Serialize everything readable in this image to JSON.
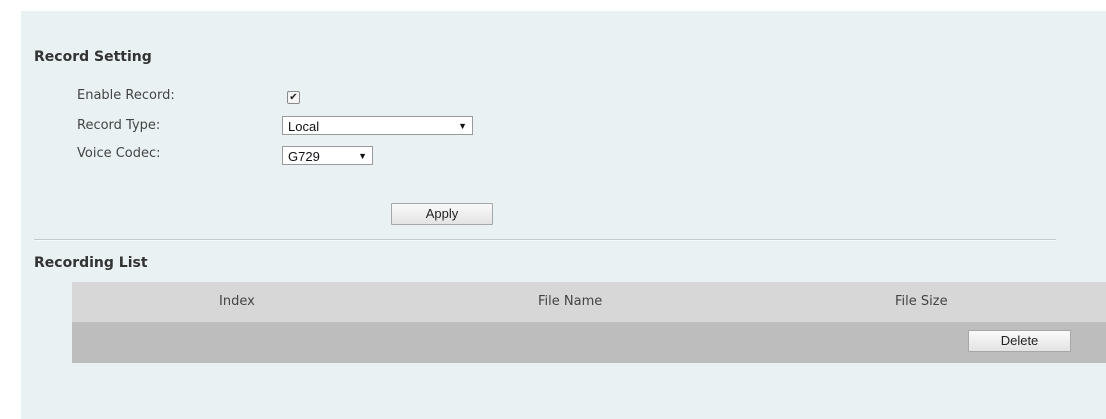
{
  "record_setting": {
    "title": "Record Setting",
    "enable_record": {
      "label": "Enable Record:",
      "checked": true,
      "check_glyph": "✔"
    },
    "record_type": {
      "label": "Record Type:",
      "value": "Local"
    },
    "voice_codec": {
      "label": "Voice Codec:",
      "value": "G729"
    },
    "apply_label": "Apply"
  },
  "recording_list": {
    "title": "Recording List",
    "columns": [
      "Index",
      "File Name",
      "File Size"
    ],
    "rows": [],
    "delete_label": "Delete"
  },
  "icons": {
    "dropdown_arrow": "▼"
  },
  "colors": {
    "panel_background": "#e9f1f2",
    "table_header": "#d7d7d7",
    "table_footer": "#bdbdbd"
  }
}
